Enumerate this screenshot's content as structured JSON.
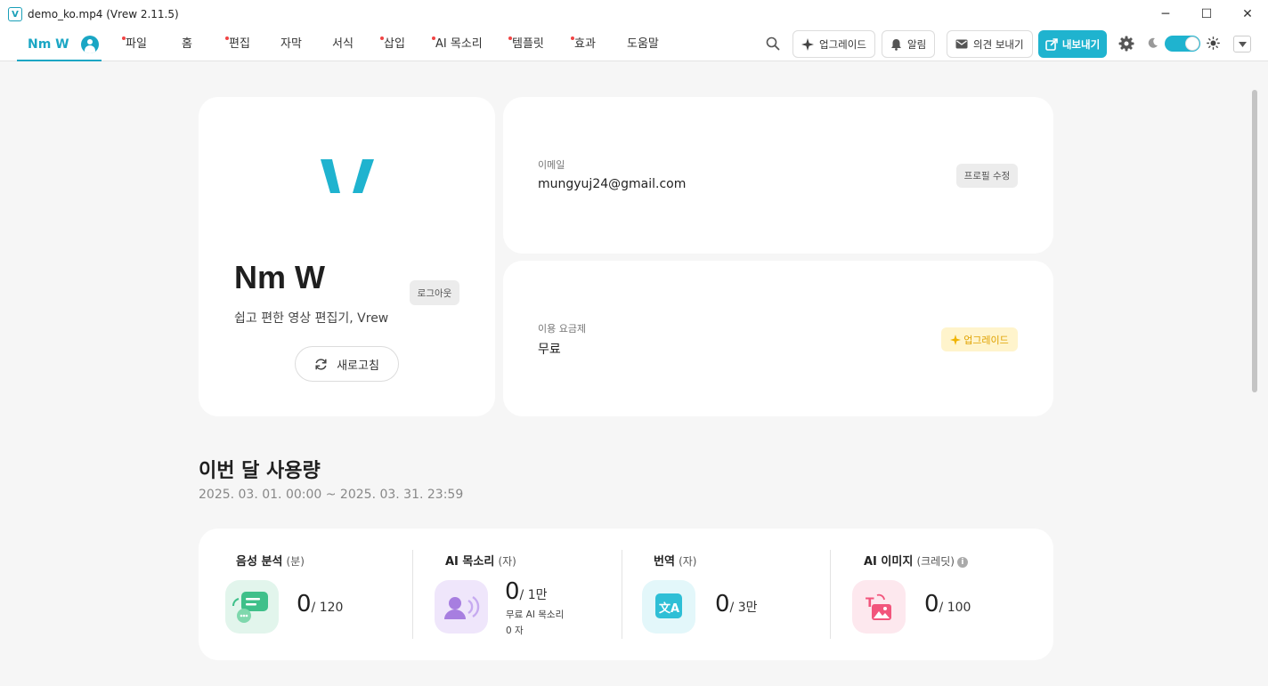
{
  "window": {
    "title": "demo_ko.mp4 (Vrew 2.11.5)",
    "app_icon": "V",
    "minimize": "─",
    "maximize": "☐",
    "close": "✕"
  },
  "menubar": {
    "user_name": "Nm W",
    "items": [
      {
        "label": "파일",
        "dot": true
      },
      {
        "label": "홈",
        "dot": false
      },
      {
        "label": "편집",
        "dot": true
      },
      {
        "label": "자막",
        "dot": false
      },
      {
        "label": "서식",
        "dot": false
      },
      {
        "label": "삽입",
        "dot": true
      },
      {
        "label": "AI 목소리",
        "dot": true
      },
      {
        "label": "템플릿",
        "dot": true
      },
      {
        "label": "효과",
        "dot": true
      },
      {
        "label": "도움말",
        "dot": false
      }
    ],
    "upgrade_label": "업그레이드",
    "alerts_label": "알림",
    "feedback_label": "의견 보내기",
    "export_label": "내보내기",
    "dark_mode_on": true
  },
  "profile": {
    "name": "Nm W",
    "logout_label": "로그아웃",
    "subtitle": "쉽고 편한 영상 편집기, Vrew",
    "refresh_label": "새로고침"
  },
  "account": {
    "email_label": "이메일",
    "email": "mungyuj24@gmail.com",
    "edit_profile_label": "프로필 수정",
    "plan_label": "이용 요금제",
    "plan": "무료",
    "upgrade_label": "업그레이드"
  },
  "usage": {
    "title": "이번 달 사용량",
    "period": "2025. 03. 01. 00:00 ~ 2025. 03. 31. 23:59",
    "stats": [
      {
        "name": "음성 분석",
        "unit": "(분)",
        "used": "0",
        "limit": "/ 120"
      },
      {
        "name": "AI 목소리",
        "unit": "(자)",
        "used": "0",
        "limit": "/ 1만",
        "sub1": "무료 AI 목소리",
        "sub2": "0 자"
      },
      {
        "name": "번역",
        "unit": "(자)",
        "used": "0",
        "limit": "/ 3만"
      },
      {
        "name": "AI 이미지",
        "unit": "(크레딧)",
        "used": "0",
        "limit": "/ 100",
        "info": "i"
      }
    ]
  },
  "colors": {
    "accent": "#1fb3cf",
    "dot": "#f04444",
    "upgrade": "#e0a200"
  }
}
